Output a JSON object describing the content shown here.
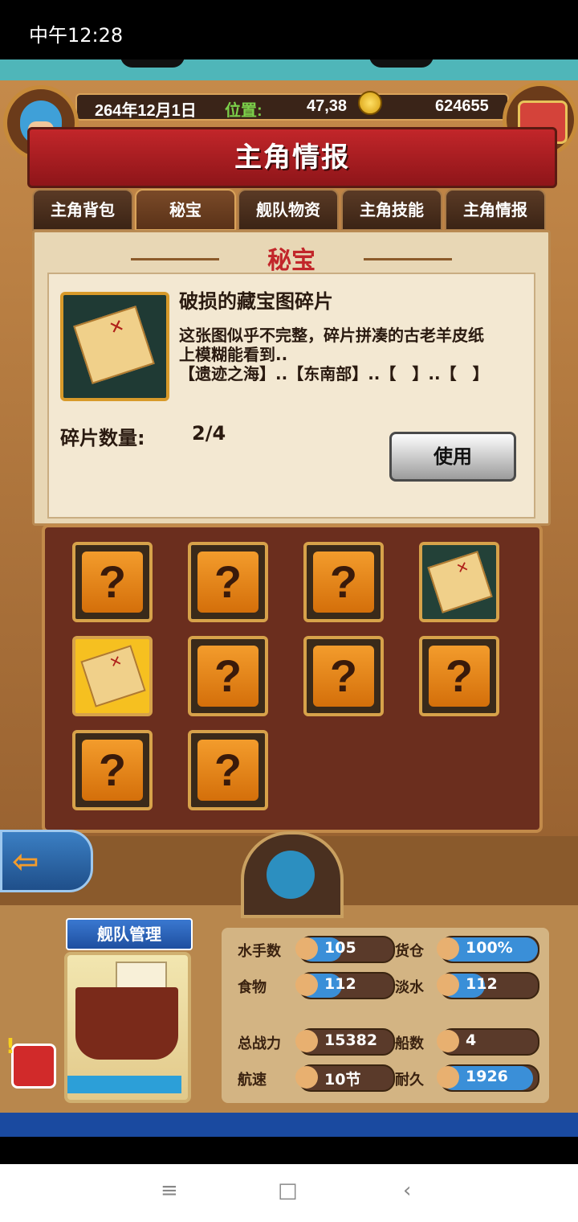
{
  "status_bar": {
    "time": "中午12:28"
  },
  "header": {
    "date": "264年12月1日",
    "position_label": "位置:",
    "position_value": "47,38",
    "gold": "624655",
    "title": "主角情报"
  },
  "tabs": [
    {
      "label": "主角背包",
      "active": false
    },
    {
      "label": "秘宝",
      "active": true
    },
    {
      "label": "舰队物资",
      "active": false
    },
    {
      "label": "主角技能",
      "active": false
    },
    {
      "label": "主角情报",
      "active": false
    }
  ],
  "panel": {
    "title": "秘宝",
    "item_name": "破损的藏宝图碎片",
    "item_desc_lines": [
      "这张图似乎不完整，碎片拼凑的古老羊皮纸",
      "上模糊能看到..",
      "【遗迹之海】..【东南部】..【　】..【　】"
    ],
    "count_label": "碎片数量:",
    "count_value": "2/4",
    "use_button": "使用"
  },
  "grid": [
    {
      "state": "unknown",
      "glyph": "?"
    },
    {
      "state": "unknown",
      "glyph": "?"
    },
    {
      "state": "unknown",
      "glyph": "?"
    },
    {
      "state": "found",
      "glyph": ""
    },
    {
      "state": "selected",
      "glyph": ""
    },
    {
      "state": "unknown",
      "glyph": "?"
    },
    {
      "state": "unknown",
      "glyph": "?"
    },
    {
      "state": "unknown",
      "glyph": "?"
    },
    {
      "state": "unknown",
      "glyph": "?"
    },
    {
      "state": "unknown",
      "glyph": "?"
    }
  ],
  "fleet": {
    "banner": "舰队管理",
    "stats": [
      {
        "label": "水手数",
        "value": "105",
        "fill": 0.45,
        "icon": "sailor-icon"
      },
      {
        "label": "货仓",
        "value": "100%",
        "fill": 1.0,
        "icon": "cargo-icon"
      },
      {
        "label": "食物",
        "value": "112",
        "fill": 0.45,
        "icon": "food-icon"
      },
      {
        "label": "淡水",
        "value": "112",
        "fill": 0.45,
        "icon": "water-icon"
      },
      {
        "label": "总战力",
        "value": "15382",
        "fill": 0.0,
        "icon": "crossed-swords-icon"
      },
      {
        "label": "船数",
        "value": "4",
        "fill": 0.0,
        "icon": "ship-count-icon"
      },
      {
        "label": "航速",
        "value": "10节",
        "fill": 0.0,
        "icon": "speed-icon"
      },
      {
        "label": "耐久",
        "value": "1926",
        "fill": 0.95,
        "icon": "durability-icon"
      }
    ]
  },
  "colors": {
    "accent_red": "#c2262a",
    "bar_blue": "#3a8fd8",
    "slot_orange": "#f39c2c"
  },
  "nav": {
    "menu": "≡",
    "home": "□",
    "back": "‹"
  }
}
